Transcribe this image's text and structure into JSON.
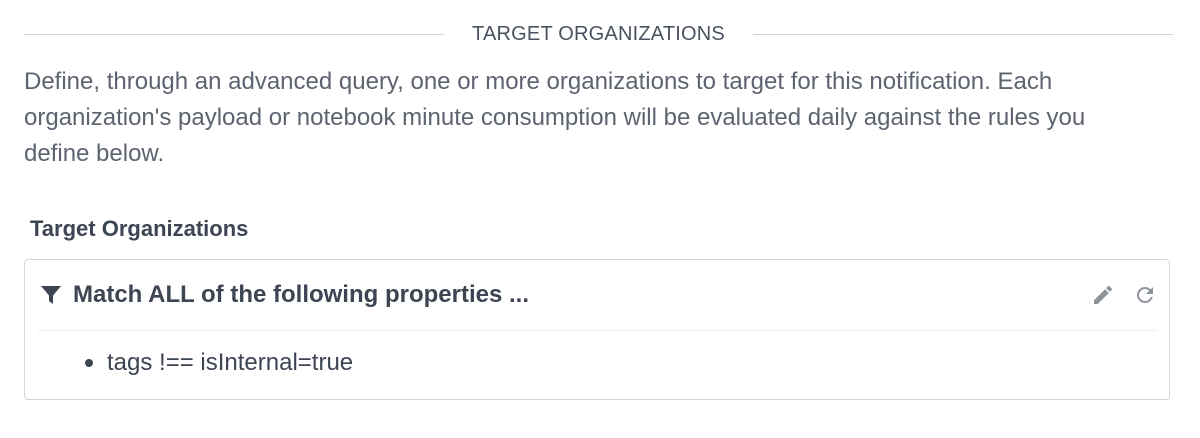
{
  "section": {
    "title": "TARGET ORGANIZATIONS",
    "description": "Define, through an advanced query, one or more organizations to target for this notification. Each organization's payload or notebook minute consumption will be evaluated daily against the rules you define below."
  },
  "field": {
    "label": "Target Organizations"
  },
  "query": {
    "match_label": "Match ALL of the following properties ...",
    "filter_icon": "filter-icon",
    "edit_icon": "pencil-icon",
    "refresh_icon": "refresh-icon",
    "rules": [
      "tags !== isInternal=true"
    ]
  },
  "colors": {
    "text": "#3d4452",
    "muted_text": "#5d6470",
    "border": "#d3d7dc",
    "icon": "#8e949c"
  }
}
